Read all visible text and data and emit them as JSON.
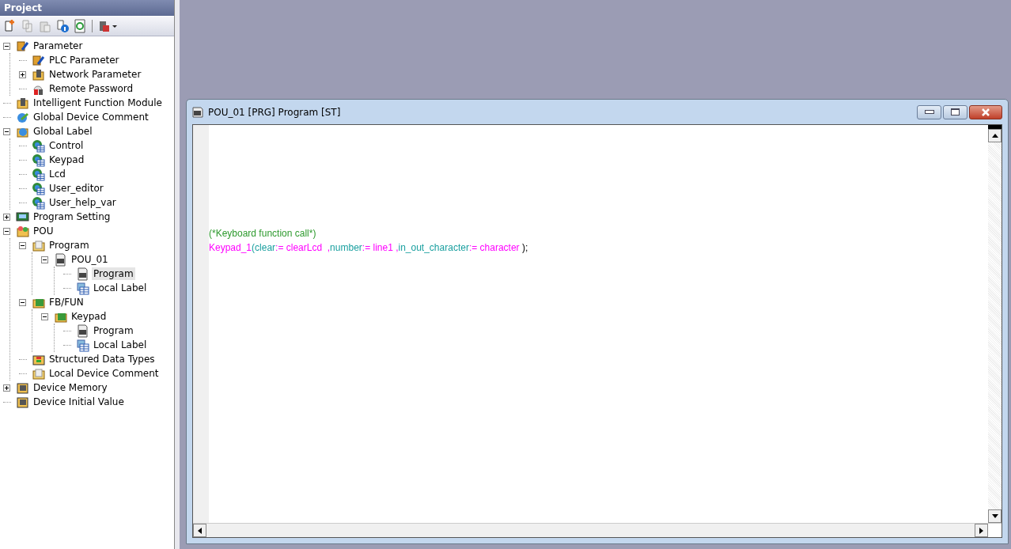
{
  "project_panel": {
    "title": "Project",
    "tree": [
      {
        "label": "Parameter",
        "kind": "param",
        "expanded": true,
        "selected": false,
        "children": [
          {
            "label": "PLC Parameter",
            "kind": "param",
            "selected": false
          },
          {
            "label": "Network Parameter",
            "kind": "module",
            "expanded": false,
            "selected": false
          },
          {
            "label": "Remote Password",
            "kind": "lock",
            "selected": false
          }
        ]
      },
      {
        "label": "Intelligent Function Module",
        "kind": "module",
        "selected": false
      },
      {
        "label": "Global Device Comment",
        "kind": "comment",
        "selected": false
      },
      {
        "label": "Global Label",
        "kind": "label",
        "expanded": true,
        "selected": false,
        "children": [
          {
            "label": "Control",
            "kind": "globe",
            "selected": false
          },
          {
            "label": "Keypad",
            "kind": "globe",
            "selected": false
          },
          {
            "label": "Lcd",
            "kind": "globe",
            "selected": false
          },
          {
            "label": "User_editor",
            "kind": "globe",
            "selected": false
          },
          {
            "label": "User_help_var",
            "kind": "globe",
            "selected": false
          }
        ]
      },
      {
        "label": "Program Setting",
        "kind": "setting",
        "expanded": false,
        "selected": false
      },
      {
        "label": "POU",
        "kind": "pou",
        "expanded": true,
        "selected": false,
        "children": [
          {
            "label": "Program",
            "kind": "folder",
            "expanded": true,
            "selected": false,
            "children": [
              {
                "label": "POU_01",
                "kind": "st",
                "expanded": true,
                "selected": false,
                "children": [
                  {
                    "label": "Program",
                    "kind": "st",
                    "selected": true
                  },
                  {
                    "label": "Local Label",
                    "kind": "table",
                    "selected": false
                  }
                ]
              }
            ]
          },
          {
            "label": "FB/FUN",
            "kind": "fb",
            "expanded": true,
            "selected": false,
            "children": [
              {
                "label": "Keypad",
                "kind": "fb",
                "expanded": true,
                "selected": false,
                "children": [
                  {
                    "label": "Program",
                    "kind": "st",
                    "selected": false
                  },
                  {
                    "label": "Local Label",
                    "kind": "table",
                    "selected": false
                  }
                ]
              }
            ]
          },
          {
            "label": "Structured Data Types",
            "kind": "struct",
            "selected": false
          },
          {
            "label": "Local Device Comment",
            "kind": "folder",
            "selected": false
          }
        ]
      },
      {
        "label": "Device Memory",
        "kind": "memory",
        "expanded": false,
        "selected": false
      },
      {
        "label": "Device Initial Value",
        "kind": "memory",
        "selected": false
      }
    ]
  },
  "editor_window": {
    "title": "POU_01 [PRG] Program [ST]",
    "lines": [
      [
        {
          "text": "(*Keyboard function call*)",
          "kind": "comment"
        }
      ],
      [
        {
          "text": "Keypad_1",
          "kind": "fb"
        },
        {
          "text": "(",
          "kind": "param"
        },
        {
          "text": "clear",
          "kind": "param"
        },
        {
          "text": ":= clearLcd  ,",
          "kind": "fb"
        },
        {
          "text": "number",
          "kind": "param"
        },
        {
          "text": ":= line1 ,",
          "kind": "fb"
        },
        {
          "text": "in_out_character",
          "kind": "param"
        },
        {
          "text": ":= character ",
          "kind": "fb"
        },
        {
          "text": ");",
          "kind": "plain"
        }
      ]
    ]
  }
}
